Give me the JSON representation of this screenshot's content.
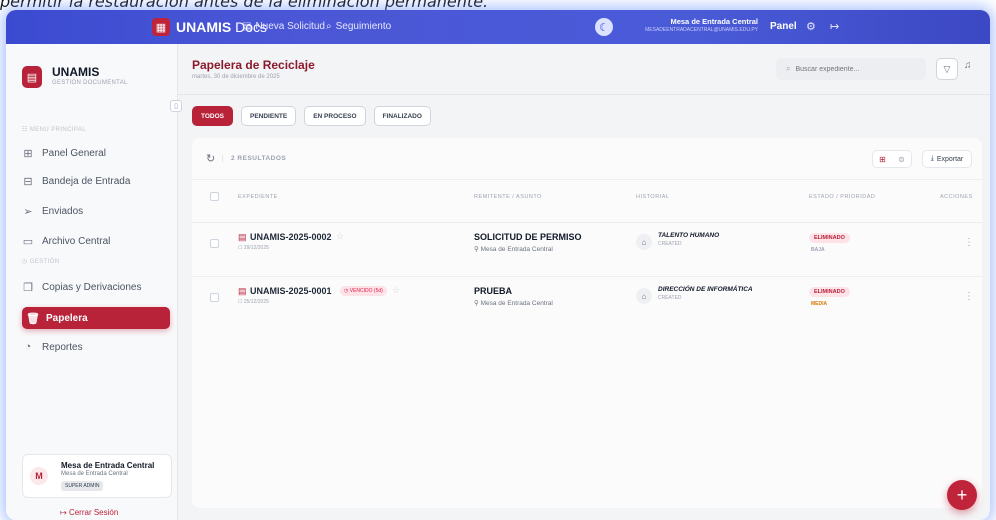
{
  "caption": "permitir la restauración antes de la eliminación permanente.",
  "topbar": {
    "brand_bold": "UNAMIS",
    "brand_rest": " Docs",
    "link_new": "Nueva Solicitud",
    "link_track": "Seguimiento",
    "user_name": "Mesa de Entrada Central",
    "user_email": "MESADEENTRADACENTRAL@UNAMIS.EDU.PY",
    "panel": "Panel"
  },
  "sidebar": {
    "title": "UNAMIS",
    "subtitle": "GESTIÓN DOCUMENTAL",
    "section_main": "MENU PRINCIPAL",
    "section_gestion": "GESTIÓN",
    "items": [
      {
        "label": "Panel General",
        "icon": "grid-icon"
      },
      {
        "label": "Bandeja de Entrada",
        "icon": "inbox-icon"
      },
      {
        "label": "Enviados",
        "icon": "send-icon"
      },
      {
        "label": "Archivo Central",
        "icon": "archive-icon"
      },
      {
        "label": "Copias y Derivaciones",
        "icon": "copy-icon"
      },
      {
        "label": "Papelera",
        "icon": "trash-icon"
      },
      {
        "label": "Reportes",
        "icon": "pie-chart-icon"
      }
    ],
    "user": {
      "initial": "M",
      "name": "Mesa de Entrada Central",
      "org": "Mesa de Entrada Central",
      "role": "SUPER ADMIN"
    },
    "logout": "Cerrar Sesión"
  },
  "main": {
    "title": "Papelera de Reciclaje",
    "date": "martes, 30 de diciembre de 2025",
    "search_placeholder": "Buscar expediente...",
    "tabs": [
      "TODOS",
      "PENDIENTE",
      "EN PROCESO",
      "FINALIZADO"
    ],
    "active_tab": "TODOS",
    "results": "2 RESULTADOS",
    "export": "Exportar",
    "columns": [
      "EXPEDIENTE",
      "REMITENTE / ASUNTO",
      "HISTORIAL",
      "ESTADO / PRIORIDAD",
      "ACCIONES"
    ],
    "rows": [
      {
        "id": "UNAMIS-2025-0002",
        "date": "29/12/2025",
        "overdue": "",
        "subject": "SOLICITUD DE PERMISO",
        "sender": "Mesa de Entrada Central",
        "dept": "TALENTO HUMANO",
        "hist_state": "CREATED",
        "status": "ELIMINADO",
        "priority": "BAJA",
        "priority_color": "#9ca3af"
      },
      {
        "id": "UNAMIS-2025-0001",
        "date": "25/12/2025",
        "overdue": "VENCIDO (5d)",
        "subject": "PRUEBA",
        "sender": "Mesa de Entrada Central",
        "dept": "DIRECCIÓN DE INFORMÁTICA",
        "hist_state": "CREATED",
        "status": "ELIMINADO",
        "priority": "MEDIA",
        "priority_color": "#d97706"
      }
    ]
  },
  "colors": {
    "accent": "#b8233a",
    "topbar": "#4a5bd8",
    "title": "#8b1a2c"
  }
}
